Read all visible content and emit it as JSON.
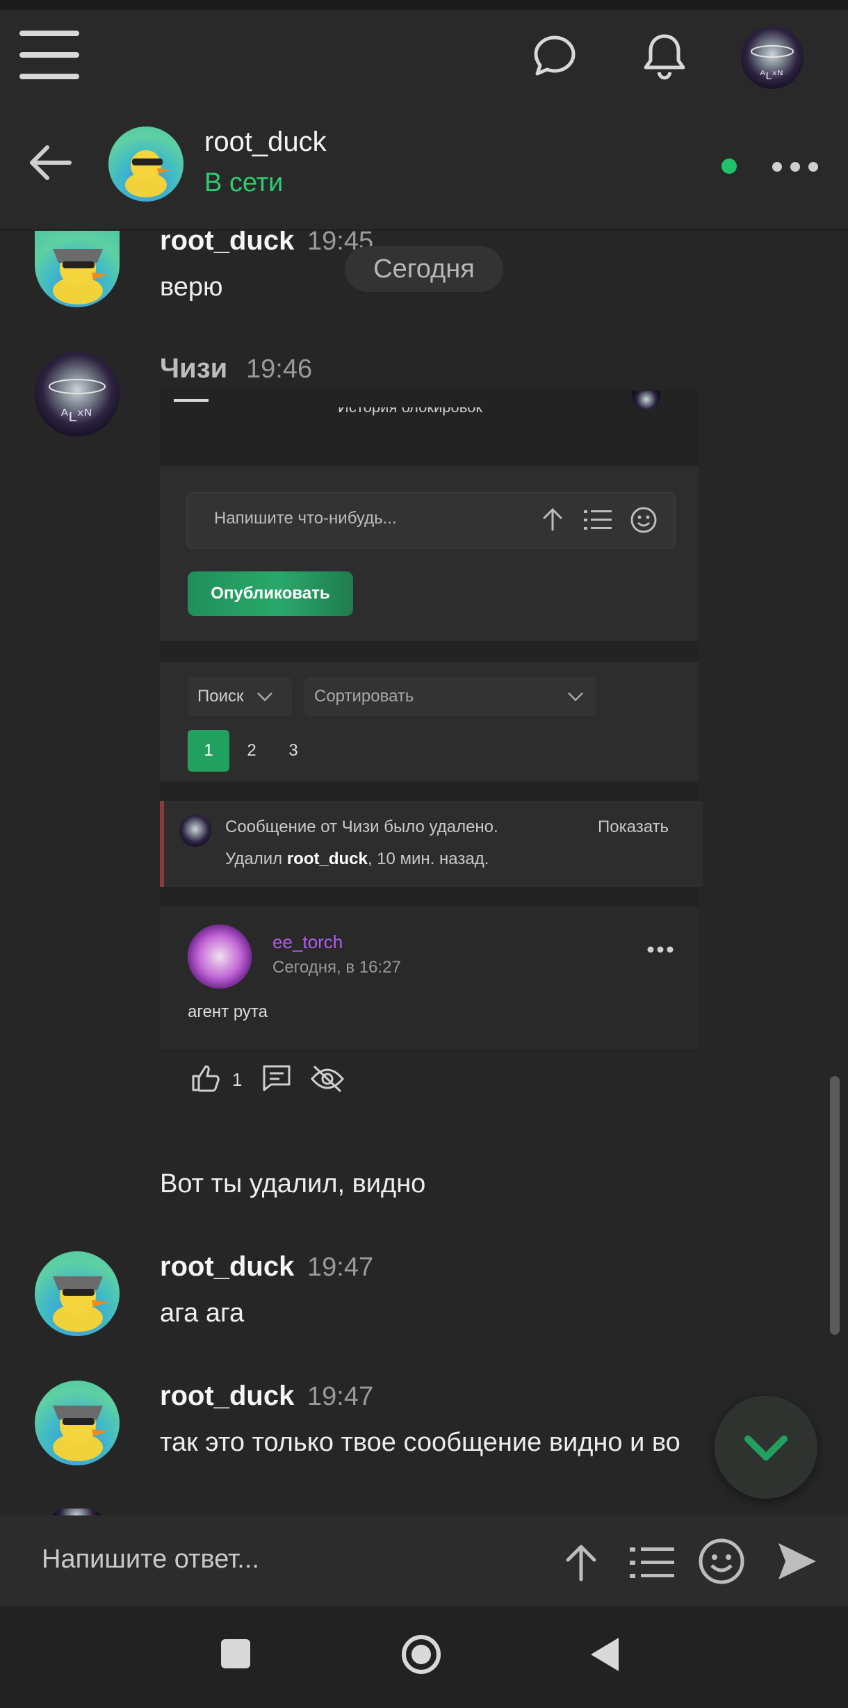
{
  "header": {
    "menu_icon": "hamburger-icon",
    "chat_icon": "speech-bubble-icon",
    "bell_icon": "bell-icon"
  },
  "chat": {
    "contact_name": "root_duck",
    "status": "В сети",
    "status_color": "#2ecc71",
    "day_label": "Сегодня"
  },
  "messages": [
    {
      "author": "root_duck",
      "time": "19:45",
      "text": "верю"
    },
    {
      "author": "Чизи",
      "time": "19:46"
    },
    {
      "text": "Вот ты удалил, видно"
    },
    {
      "author": "root_duck",
      "time": "19:47",
      "text": "ага ага"
    },
    {
      "author": "root_duck",
      "time": "19:47",
      "text": "так это только твое сообщение видно и во"
    }
  ],
  "screenshot": {
    "cut_title": "История блокировок",
    "input_placeholder": "Напишите что-нибудь...",
    "publish_label": "Опубликовать",
    "search_label": "Поиск",
    "sort_label": "Сортировать",
    "pages": [
      "1",
      "2",
      "3"
    ],
    "deleted_text": "Сообщение от Чизи было удалено.",
    "show_label": "Показать",
    "deleted_by_prefix": "Удалил ",
    "deleted_by_user": "root_duck",
    "deleted_by_suffix": ", 10 мин. назад.",
    "post_author": "ee_torch",
    "post_author_color": "#b05cf0",
    "post_time": "Сегодня, в 16:27",
    "post_text": "агент рута",
    "like_count": "1"
  },
  "composer": {
    "placeholder": "Напишите ответ..."
  },
  "accent": "#22a05f"
}
